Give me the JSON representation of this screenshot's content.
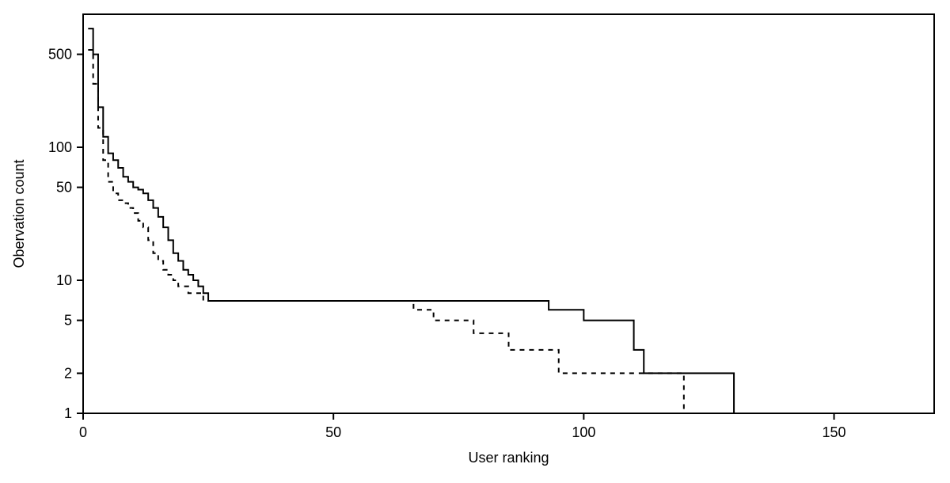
{
  "chart_data": {
    "type": "line",
    "title": "",
    "xlabel": "User ranking",
    "ylabel": "Obervation count",
    "xlim": [
      0,
      170
    ],
    "ylim": [
      1,
      1000
    ],
    "y_scale": "log",
    "x_ticks": [
      0,
      50,
      100,
      150
    ],
    "y_ticks": [
      1,
      2,
      5,
      10,
      50,
      100,
      500
    ],
    "series": [
      {
        "name": "solid",
        "style": "solid",
        "x": [
          1,
          2,
          3,
          4,
          5,
          6,
          7,
          8,
          9,
          10,
          11,
          12,
          13,
          14,
          15,
          16,
          17,
          18,
          19,
          20,
          21,
          22,
          23,
          24,
          25,
          30,
          40,
          50,
          60,
          70,
          80,
          85,
          90,
          93,
          96,
          100,
          103,
          107,
          110,
          112,
          118,
          125,
          130,
          140,
          150,
          160,
          170
        ],
        "values": [
          780,
          500,
          200,
          120,
          90,
          80,
          70,
          60,
          55,
          50,
          48,
          45,
          40,
          35,
          30,
          25,
          20,
          16,
          14,
          12,
          11,
          10,
          9,
          8,
          7,
          7,
          7,
          7,
          7,
          7,
          7,
          7,
          7,
          6,
          6,
          5,
          5,
          5,
          3,
          2,
          2,
          2,
          1,
          1,
          1,
          1,
          1
        ]
      },
      {
        "name": "dashed",
        "style": "dashed",
        "x": [
          1,
          2,
          3,
          4,
          5,
          6,
          7,
          8,
          9,
          10,
          11,
          12,
          13,
          14,
          15,
          16,
          17,
          18,
          19,
          20,
          21,
          22,
          23,
          24,
          25,
          30,
          40,
          50,
          60,
          63,
          66,
          70,
          74,
          78,
          80,
          85,
          88,
          92,
          95,
          100,
          110,
          115,
          120,
          125
        ],
        "values": [
          540,
          300,
          140,
          80,
          55,
          45,
          40,
          38,
          35,
          32,
          28,
          25,
          20,
          16,
          14,
          12,
          11,
          10,
          9,
          9,
          8,
          8,
          8,
          7,
          7,
          7,
          7,
          7,
          7,
          7,
          6,
          5,
          5,
          4,
          4,
          3,
          3,
          3,
          2,
          2,
          2,
          2,
          1,
          1
        ]
      }
    ]
  }
}
